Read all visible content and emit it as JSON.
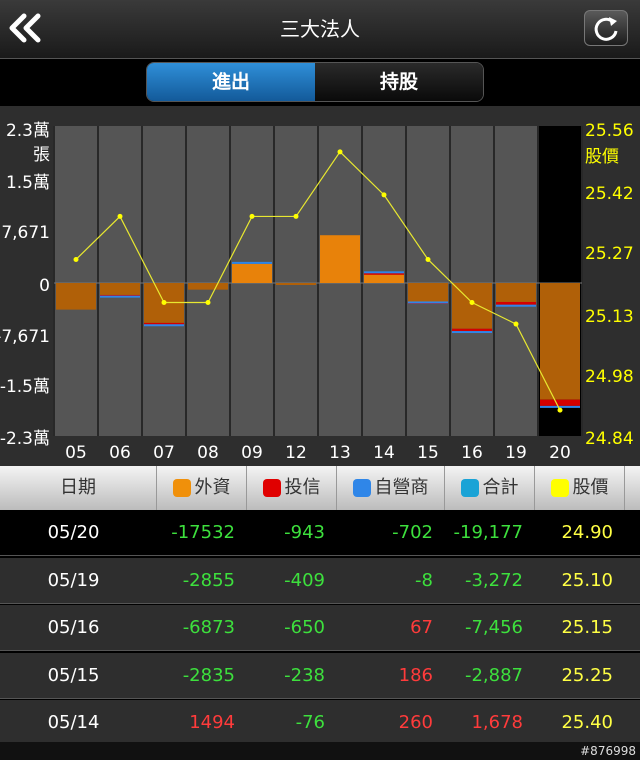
{
  "header": {
    "title": "三大法人"
  },
  "tabs": [
    {
      "label": "進出",
      "active": true
    },
    {
      "label": "持股",
      "active": false
    }
  ],
  "chart_data": {
    "type": "bar",
    "categories": [
      "05",
      "06",
      "07",
      "08",
      "09",
      "12",
      "13",
      "14",
      "15",
      "16",
      "19",
      "20"
    ],
    "y_left_ticks": [
      "2.3萬",
      "張",
      "1.5萬",
      "7,671",
      "0",
      "-7,671",
      "-1.5萬",
      "-2.3萬"
    ],
    "y_right_ticks": [
      "25.56",
      "股價",
      "25.42",
      "25.27",
      "25.13",
      "24.98",
      "24.84"
    ],
    "ylim_left": [
      -23000,
      23000
    ],
    "ylim_right": [
      24.84,
      25.56
    ],
    "series": [
      {
        "name": "外資",
        "values": [
          -4000,
          -1800,
          -6000,
          -1000,
          2800,
          -300,
          7000,
          1494,
          -2835,
          -6873,
          -2855,
          -17532
        ]
      },
      {
        "name": "投信",
        "values": [
          0,
          -100,
          -200,
          0,
          0,
          0,
          0,
          -76,
          -238,
          -650,
          -409,
          -943
        ]
      },
      {
        "name": "自營商",
        "values": [
          0,
          -200,
          -300,
          0,
          200,
          0,
          0,
          260,
          186,
          67,
          -8,
          -702
        ]
      },
      {
        "name": "股價",
        "values": [
          25.25,
          25.35,
          25.15,
          25.15,
          25.35,
          25.35,
          25.5,
          25.4,
          25.25,
          25.15,
          25.1,
          24.9
        ]
      }
    ],
    "colors": {
      "foreign": "#e8820a",
      "trust": "#d40000",
      "dealer": "#2f86e8",
      "total": "#1aa3d6",
      "price": "#ffff00"
    }
  },
  "table": {
    "headers": [
      "日期",
      "外資",
      "投信",
      "自營商",
      "合計",
      "股價"
    ],
    "rows": [
      [
        "05/20",
        "-17532",
        "-943",
        "-702",
        "-19,177",
        "24.90"
      ],
      [
        "05/19",
        "-2855",
        "-409",
        "-8",
        "-3,272",
        "25.10"
      ],
      [
        "05/16",
        "-6873",
        "-650",
        "67",
        "-7,456",
        "25.15"
      ],
      [
        "05/15",
        "-2835",
        "-238",
        "186",
        "-2,887",
        "25.25"
      ],
      [
        "05/14",
        "1494",
        "-76",
        "260",
        "1,678",
        "25.40"
      ]
    ]
  },
  "watermark": "#876998"
}
